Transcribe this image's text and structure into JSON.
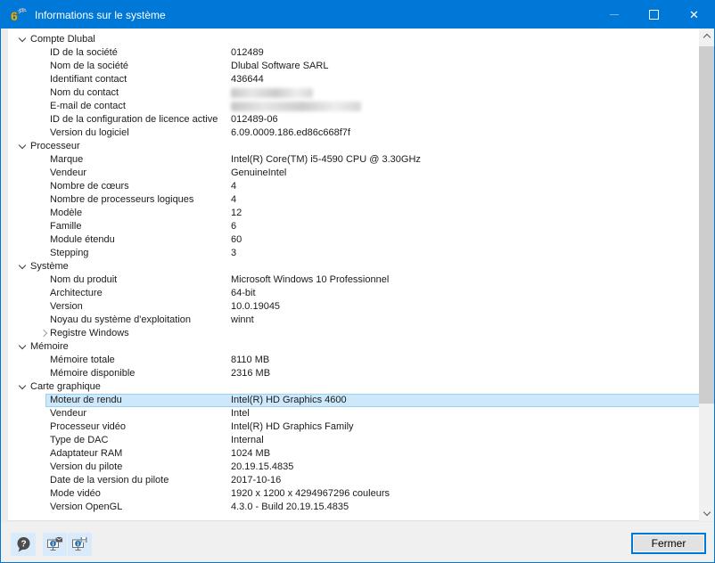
{
  "window": {
    "title": "Informations sur le système",
    "app_icon": "rfem6-logo-icon"
  },
  "colors": {
    "titlebar": "#0078d7",
    "window_border": "#0078d7",
    "selection_fill": "#cde8fa",
    "selection_border": "#9ad1f3",
    "tool_button_bg": "#d9eafb",
    "list_bg": "#ffffff",
    "footer_bg": "#f0f0f0"
  },
  "tree": {
    "sections": [
      {
        "label": "Compte Dlubal",
        "expanded": true,
        "items": [
          {
            "label": "ID de la société",
            "value": "012489"
          },
          {
            "label": "Nom de la société",
            "value": "Dlubal Software SARL"
          },
          {
            "label": "Identifiant contact",
            "value": "436644"
          },
          {
            "label": "Nom du contact",
            "value": "",
            "redacted": true,
            "redacted_size": "small"
          },
          {
            "label": "E-mail de contact",
            "value": "",
            "redacted": true,
            "redacted_size": "large"
          },
          {
            "label": "ID de la configuration de licence active",
            "value": "012489-06"
          },
          {
            "label": "Version du logiciel",
            "value": "6.09.0009.186.ed86c668f7f"
          }
        ]
      },
      {
        "label": "Processeur",
        "expanded": true,
        "items": [
          {
            "label": "Marque",
            "value": "Intel(R) Core(TM) i5-4590 CPU @ 3.30GHz"
          },
          {
            "label": "Vendeur",
            "value": "GenuineIntel"
          },
          {
            "label": "Nombre de cœurs",
            "value": "4"
          },
          {
            "label": "Nombre de processeurs logiques",
            "value": "4"
          },
          {
            "label": "Modèle",
            "value": "12"
          },
          {
            "label": "Famille",
            "value": "6"
          },
          {
            "label": "Module étendu",
            "value": "60"
          },
          {
            "label": "Stepping",
            "value": "3"
          }
        ]
      },
      {
        "label": "Système",
        "expanded": true,
        "items": [
          {
            "label": "Nom du produit",
            "value": "Microsoft Windows 10 Professionnel"
          },
          {
            "label": "Architecture",
            "value": "64-bit"
          },
          {
            "label": "Version",
            "value": "10.0.19045"
          },
          {
            "label": "Noyau du système d'exploitation",
            "value": "winnt"
          },
          {
            "label": "Registre Windows",
            "value": "",
            "collapsible": true,
            "expanded": false
          }
        ]
      },
      {
        "label": "Mémoire",
        "expanded": true,
        "items": [
          {
            "label": "Mémoire totale",
            "value": "8110 MB"
          },
          {
            "label": "Mémoire disponible",
            "value": "2316 MB"
          }
        ]
      },
      {
        "label": "Carte graphique",
        "expanded": true,
        "items": [
          {
            "label": "Moteur de rendu",
            "value": "Intel(R) HD Graphics 4600",
            "selected": true
          },
          {
            "label": "Vendeur",
            "value": "Intel"
          },
          {
            "label": "Processeur vidéo",
            "value": "Intel(R) HD Graphics Family"
          },
          {
            "label": "Type de DAC",
            "value": "Internal"
          },
          {
            "label": "Adaptateur RAM",
            "value": "1024 MB"
          },
          {
            "label": "Version du pilote",
            "value": "20.19.15.4835"
          },
          {
            "label": "Date de la version du pilote",
            "value": "2017-10-16"
          },
          {
            "label": "Mode vidéo",
            "value": "1920 x 1200 x 4294967296 couleurs"
          },
          {
            "label": "Version OpenGL",
            "value": "4.3.0 - Build 20.19.15.4835"
          }
        ]
      }
    ]
  },
  "footer": {
    "tool_icons": [
      "help-balloon-icon",
      "system-info-mail-icon",
      "system-info-save-icon"
    ],
    "close_label": "Fermer"
  }
}
